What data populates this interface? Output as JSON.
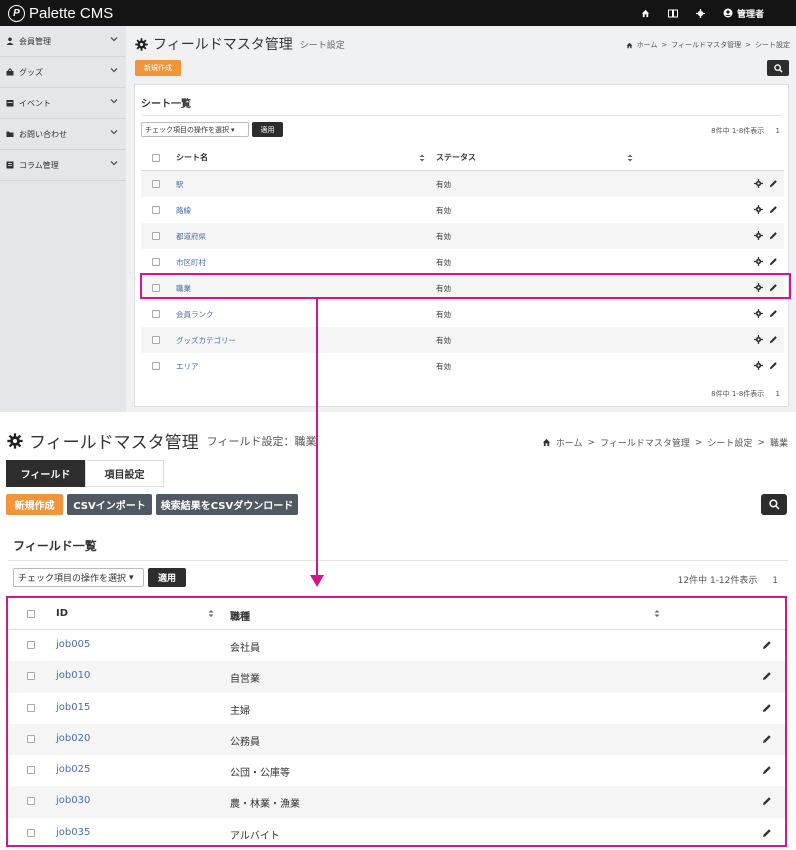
{
  "app": {
    "logo_text": "Palette CMS",
    "logo_mark": "P",
    "admin_label": "管理者"
  },
  "sidebar": {
    "items": [
      {
        "label": "会員管理",
        "icon": "user-icon"
      },
      {
        "label": "グッズ",
        "icon": "bag-icon"
      },
      {
        "label": "イベント",
        "icon": "calendar-icon"
      },
      {
        "label": "お問い合わせ",
        "icon": "folder-icon"
      },
      {
        "label": "コラム管理",
        "icon": "book-icon"
      }
    ]
  },
  "sheet_page": {
    "title": "フィールドマスタ管理",
    "subtitle": "シート設定",
    "breadcrumb": [
      "ホーム",
      "フィールドマスタ管理",
      "シート設定"
    ],
    "new_button": "新規作成",
    "card_title": "シート一覧",
    "bulk_action": "チェック項目の操作を選択",
    "apply_button": "適用",
    "count_text": "8件中 1-8件表示",
    "page_number": "1",
    "columns": [
      "シート名",
      "ステータス"
    ],
    "rows": [
      {
        "name": "駅",
        "status": "有効"
      },
      {
        "name": "路線",
        "status": "有効"
      },
      {
        "name": "都道府県",
        "status": "有効"
      },
      {
        "name": "市区町村",
        "status": "有効"
      },
      {
        "name": "職業",
        "status": "有効"
      },
      {
        "name": "会員ランク",
        "status": "有効"
      },
      {
        "name": "グッズカテゴリー",
        "status": "有効"
      },
      {
        "name": "エリア",
        "status": "有効"
      }
    ]
  },
  "field_page": {
    "title": "フィールドマスタ管理",
    "subtitle": "フィールド設定：職業",
    "breadcrumb": [
      "ホーム",
      "フィールドマスタ管理",
      "シート設定",
      "職業"
    ],
    "tabs": [
      "フィールド",
      "項目設定"
    ],
    "new_button": "新規作成",
    "csv_import_button": "CSVインポート",
    "csv_download_button": "検索結果をCSVダウンロード",
    "card_title": "フィールド一覧",
    "bulk_action": "チェック項目の操作を選択",
    "apply_button": "適用",
    "count_text": "12件中 1-12件表示",
    "page_number": "1",
    "columns": [
      "ID",
      "職種"
    ],
    "rows": [
      {
        "id": "job005",
        "job": "会社員"
      },
      {
        "id": "job010",
        "job": "自営業"
      },
      {
        "id": "job015",
        "job": "主婦"
      },
      {
        "id": "job020",
        "job": "公務員"
      },
      {
        "id": "job025",
        "job": "公団・公庫等"
      },
      {
        "id": "job030",
        "job": "農・林業・漁業"
      },
      {
        "id": "job035",
        "job": "アルバイト"
      }
    ]
  },
  "colors": {
    "accent_orange": "#f0953a",
    "highlight_magenta": "#d0188c",
    "dark": "#2d2d2d",
    "link_blue": "#4a6ea9"
  }
}
